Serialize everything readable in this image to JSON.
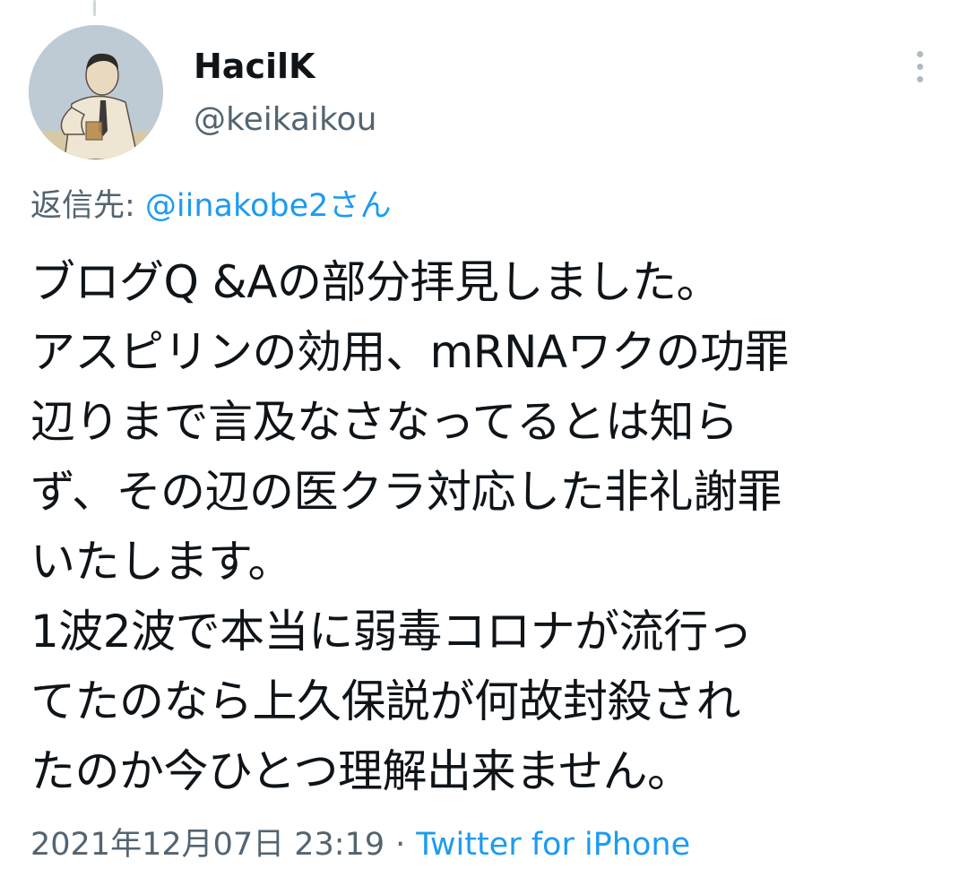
{
  "author": {
    "display_name": "HacilK",
    "handle": "@keikaikou"
  },
  "reply": {
    "prefix": "返信先: ",
    "mention": "@iinakobe2さん"
  },
  "tweet": {
    "lines": [
      "ブログQ &Aの部分拝見しました。",
      "アスピリンの効用、mRNAワクの功罪",
      "辺りまで言及なさなってるとは知ら",
      "ず、その辺の医クラ対応した非礼謝罪",
      "いたします。",
      "1波2波で本当に弱毒コロナが流行っ",
      "てたのなら上久保説が何故封殺され",
      "たのか今ひとつ理解出来ません。"
    ]
  },
  "meta": {
    "timestamp": "2021年12月07日 23:19",
    "separator": "·",
    "source": "Twitter for iPhone"
  },
  "icons": {
    "more": "more-vertical-icon"
  },
  "colors": {
    "text": "#0f1419",
    "secondary": "#536471",
    "link": "#1d9bf0"
  }
}
